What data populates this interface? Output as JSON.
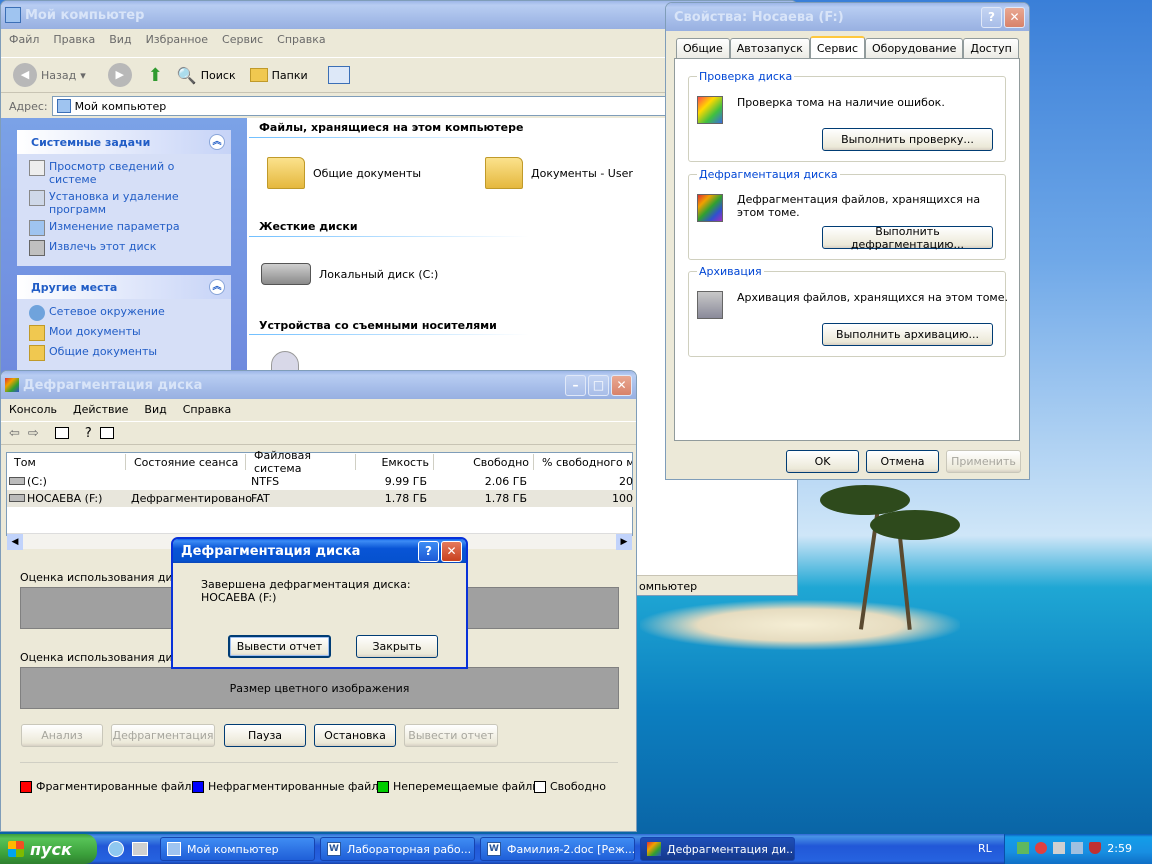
{
  "colors": {
    "titlebar": "#0a5fe8",
    "accent_link": "#215dc6",
    "legend_fragmented": "#ff0000",
    "legend_contiguous": "#0000ff",
    "legend_unmovable": "#00cc00",
    "legend_free": "#ffffff"
  },
  "mycomp": {
    "title": "Мой компьютер",
    "menu": [
      "Файл",
      "Правка",
      "Вид",
      "Избранное",
      "Сервис",
      "Справка"
    ],
    "toolbar": {
      "back": "Назад",
      "search": "Поиск",
      "folders": "Папки"
    },
    "address_label": "Адрес:",
    "address_value": "Мой компьютер",
    "tasks_head": "Системные задачи",
    "tasks": [
      "Просмотр сведений о системе",
      "Установка и удаление программ",
      "Изменение параметра",
      "Извлечь этот диск"
    ],
    "places_head": "Другие места",
    "places": [
      "Сетевое окружение",
      "Мои документы",
      "Общие документы"
    ],
    "sec_files": "Файлы, хранящиеся на этом компьютере",
    "shared_docs": "Общие документы",
    "user_docs": "Документы - User",
    "sec_drives": "Жесткие диски",
    "local_disk": "Локальный диск (C:)",
    "sec_removable": "Устройства со съемными носителями",
    "status_frag": "омпьютер"
  },
  "props": {
    "title": "Свойства: Носаева (F:)",
    "tabs": [
      "Общие",
      "Автозапуск",
      "Сервис",
      "Оборудование",
      "Доступ"
    ],
    "check_group": "Проверка диска",
    "check_text": "Проверка тома на наличие ошибок.",
    "check_btn": "Выполнить проверку...",
    "defrag_group": "Дефрагментация диска",
    "defrag_text": "Дефрагментация файлов, хранящихся на этом томе.",
    "defrag_btn": "Выполнить дефрагментацию...",
    "backup_group": "Архивация",
    "backup_text": "Архивация файлов, хранящихся на этом томе.",
    "backup_btn": "Выполнить архивацию...",
    "ok": "OK",
    "cancel": "Отмена",
    "apply": "Применить"
  },
  "defrag": {
    "title": "Дефрагментация диска",
    "menu": [
      "Консоль",
      "Действие",
      "Вид",
      "Справка"
    ],
    "columns": [
      "Том",
      "Состояние сеанса",
      "Файловая система",
      "Емкость",
      "Свободно",
      "% свободного ме"
    ],
    "rows": [
      {
        "vol": "(C:)",
        "state": "",
        "fs": "NTFS",
        "cap": "9.99 ГБ",
        "free": "2.06 ГБ",
        "pct": "20"
      },
      {
        "vol": "НОСАЕВА (F:)",
        "state": "Дефрагментировано",
        "fs": "FAT",
        "cap": "1.78 ГБ",
        "free": "1.78 ГБ",
        "pct": "100"
      }
    ],
    "est_before": "Оценка использования диска",
    "est_after": "Оценка использования диска",
    "color_size": "Размер цветного изображения",
    "buttons": {
      "analyze": "Анализ",
      "defrag": "Дефрагментация",
      "pause": "Пауза",
      "stop": "Остановка",
      "report": "Вывести отчет"
    },
    "legend": [
      "Фрагментированные файлы",
      "Нефрагментированные файлы",
      "Неперемещаемые файлы",
      "Свободно"
    ]
  },
  "dialog": {
    "title": "Дефрагментация диска",
    "line1": "Завершена дефрагментация диска:",
    "line2": "НОСАЕВА (F:)",
    "report_btn": "Вывести отчет",
    "close_btn": "Закрыть"
  },
  "taskbar": {
    "start": "пуск",
    "tasks": [
      "Мой компьютер",
      "Лабораторная рабо...",
      "Фамилия-2.doc [Реж...",
      "Дефрагментация ди..."
    ],
    "lang": "RL",
    "clock": "2:59"
  }
}
